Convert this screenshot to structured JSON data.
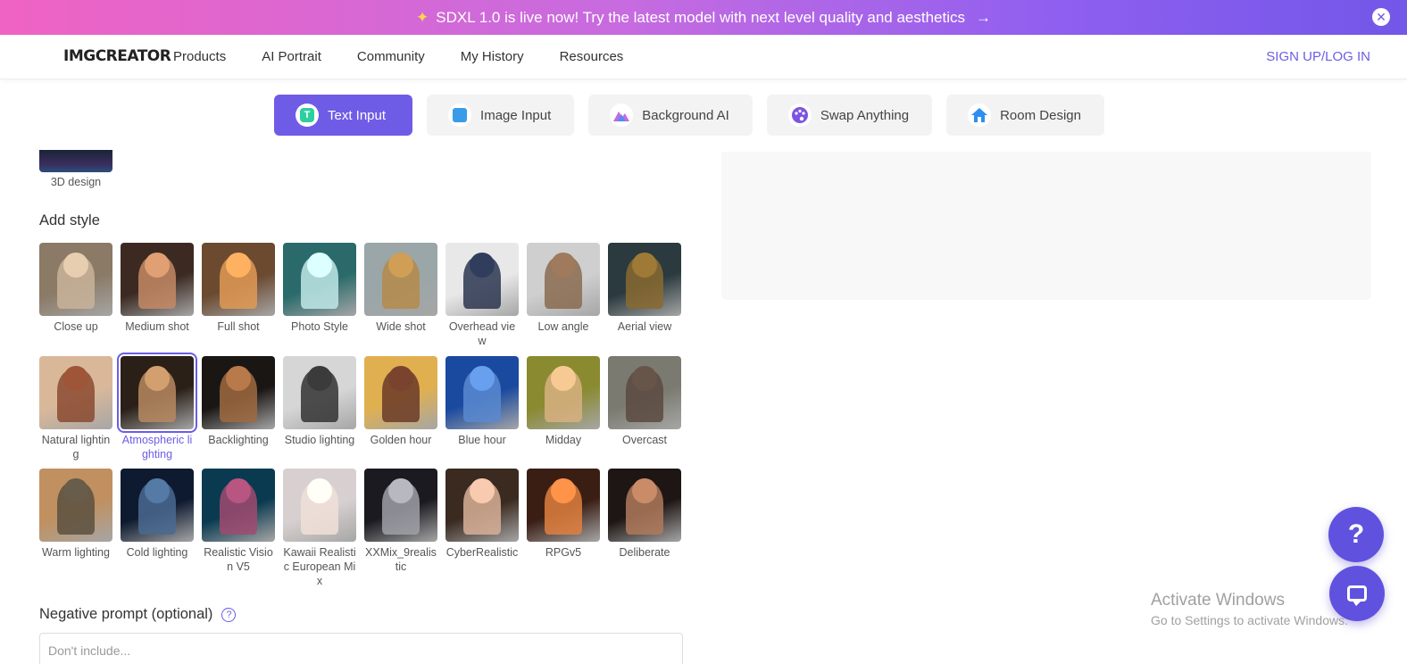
{
  "banner": {
    "text": "SDXL 1.0 is live now! Try the latest model with next level quality and aesthetics",
    "spark_icon": "sparkle-icon",
    "arrow": "→",
    "close": "✕"
  },
  "nav": {
    "logo": "IMGCREATOR",
    "links": [
      "Products",
      "AI Portrait",
      "Community",
      "My History",
      "Resources"
    ],
    "signup": "SIGN UP/LOG IN"
  },
  "tabs": [
    {
      "label": "Text Input",
      "icon": "T",
      "color": "#2ccfa0",
      "active": true
    },
    {
      "label": "Image Input",
      "icon": "",
      "color": "#3a9be8",
      "active": false
    },
    {
      "label": "Background AI",
      "icon": "",
      "color": "#c56ae0",
      "active": false
    },
    {
      "label": "Swap Anything",
      "icon": "",
      "color": "#7b55e0",
      "active": false
    },
    {
      "label": "Room Design",
      "icon": "",
      "color": "#2e8ff0",
      "active": false
    }
  ],
  "partial_style": {
    "label": "3D design"
  },
  "add_style": {
    "title": "Add style",
    "selected_index": 9,
    "items": [
      {
        "label": "Close up",
        "bg": "#8a7a66",
        "fg": "#c9b39a"
      },
      {
        "label": "Medium shot",
        "bg": "#3c2a22",
        "fg": "#c48a65"
      },
      {
        "label": "Full shot",
        "bg": "#6b4a30",
        "fg": "#e09a55"
      },
      {
        "label": "Photo Style",
        "bg": "#2a6a6a",
        "fg": "#bfe8e8"
      },
      {
        "label": "Wide shot",
        "bg": "#9aa6a8",
        "fg": "#b58a4a"
      },
      {
        "label": "Overhead view",
        "bg": "#e8e8e8",
        "fg": "#2a3550"
      },
      {
        "label": "Low angle",
        "bg": "#cfcfcf",
        "fg": "#8a6a50"
      },
      {
        "label": "Aerial view",
        "bg": "#2a3a3e",
        "fg": "#8a6a30"
      },
      {
        "label": "Natural lighting",
        "bg": "#d9b89a",
        "fg": "#8a4a30"
      },
      {
        "label": "Atmospheric lighting",
        "bg": "#2a2018",
        "fg": "#b88a60"
      },
      {
        "label": "Backlighting",
        "bg": "#1a1614",
        "fg": "#a06a40"
      },
      {
        "label": "Studio lighting",
        "bg": "#d6d6d6",
        "fg": "#333333"
      },
      {
        "label": "Golden hour",
        "bg": "#e0b050",
        "fg": "#6a3a28"
      },
      {
        "label": "Blue hour",
        "bg": "#1a4aa0",
        "fg": "#5a8ad0"
      },
      {
        "label": "Midday",
        "bg": "#8a8a30",
        "fg": "#d8b080"
      },
      {
        "label": "Overcast",
        "bg": "#7a7a70",
        "fg": "#5a4a40"
      },
      {
        "label": "Warm lighting",
        "bg": "#c09060",
        "fg": "#5a5040"
      },
      {
        "label": "Cold lighting",
        "bg": "#0e1a30",
        "fg": "#4a6a90"
      },
      {
        "label": "Realistic Vision V5",
        "bg": "#0a3a50",
        "fg": "#a04a70"
      },
      {
        "label": "Kawaii Realistic European Mix",
        "bg": "#d8d0d0",
        "fg": "#f0e0d8"
      },
      {
        "label": "XXMix_9realistic",
        "bg": "#1a1a20",
        "fg": "#a0a0a8"
      },
      {
        "label": "CyberRealistic",
        "bg": "#3a2a20",
        "fg": "#d8b098"
      },
      {
        "label": "RPGv5",
        "bg": "#3a1e14",
        "fg": "#e08040"
      },
      {
        "label": "Deliberate",
        "bg": "#1e1614",
        "fg": "#b07a5a"
      }
    ]
  },
  "negative_prompt": {
    "title": "Negative prompt (optional)",
    "help": "?",
    "placeholder": "Don't include..."
  },
  "fab": {
    "help": "?"
  },
  "watermark": {
    "title": "Activate Windows",
    "subtitle": "Go to Settings to activate Windows."
  }
}
